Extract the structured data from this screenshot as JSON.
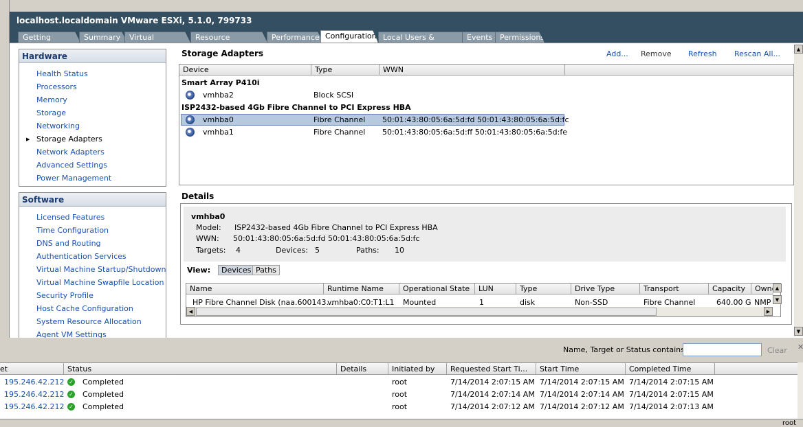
{
  "window_title": "localhost.localdomain VMware ESXi, 5.1.0, 799733",
  "tabs": [
    {
      "label": "Getting Started"
    },
    {
      "label": "Summary"
    },
    {
      "label": "Virtual Machines"
    },
    {
      "label": "Resource Allocation"
    },
    {
      "label": "Performance"
    },
    {
      "label": "Configuration"
    },
    {
      "label": "Local Users & Groups"
    },
    {
      "label": "Events"
    },
    {
      "label": "Permissions"
    }
  ],
  "active_tab": "Configuration",
  "hardware": {
    "title": "Hardware",
    "items": [
      "Health Status",
      "Processors",
      "Memory",
      "Storage",
      "Networking",
      "Storage Adapters",
      "Network Adapters",
      "Advanced Settings",
      "Power Management"
    ],
    "selected": "Storage Adapters"
  },
  "software": {
    "title": "Software",
    "items": [
      "Licensed Features",
      "Time Configuration",
      "DNS and Routing",
      "Authentication Services",
      "Virtual Machine Startup/Shutdown",
      "Virtual Machine Swapfile Location",
      "Security Profile",
      "Host Cache Configuration",
      "System Resource Allocation",
      "Agent VM Settings"
    ]
  },
  "storage_adapters": {
    "title": "Storage Adapters",
    "actions": {
      "add": "Add...",
      "remove": "Remove",
      "refresh": "Refresh",
      "rescan": "Rescan All..."
    },
    "columns": [
      "Device",
      "Type",
      "WWN"
    ],
    "groups": [
      {
        "name": "Smart Array P410i"
      },
      {
        "name": "ISP2432-based 4Gb Fibre Channel to PCI Express HBA"
      }
    ],
    "rows": [
      {
        "device": "vmhba2",
        "type": "Block SCSI",
        "wwn": ""
      },
      {
        "device": "vmhba0",
        "type": "Fibre Channel",
        "wwn": "50:01:43:80:05:6a:5d:fd 50:01:43:80:05:6a:5d:fc"
      },
      {
        "device": "vmhba1",
        "type": "Fibre Channel",
        "wwn": "50:01:43:80:05:6a:5d:ff 50:01:43:80:05:6a:5d:fe"
      }
    ]
  },
  "details": {
    "title": "Details",
    "adapter": "vmhba0",
    "model_label": "Model:",
    "model": "ISP2432-based 4Gb Fibre Channel to PCI Express HBA",
    "wwn_label": "WWN:",
    "wwn": "50:01:43:80:05:6a:5d:fd 50:01:43:80:05:6a:5d:fc",
    "targets_label": "Targets:",
    "targets": "4",
    "devices_label": "Devices:",
    "devices": "5",
    "paths_label": "Paths:",
    "paths": "10",
    "view_label": "View:",
    "view_devices": "Devices",
    "view_paths": "Paths",
    "columns": [
      "Name",
      "Runtime Name",
      "Operational State",
      "LUN",
      "Type",
      "Drive Type",
      "Transport",
      "Capacity",
      "Owne"
    ],
    "row": {
      "name": "HP Fibre Channel Disk (naa.600143...",
      "runtime": "vmhba0:C0:T1:L1",
      "state": "Mounted",
      "lun": "1",
      "type": "disk",
      "drive": "Non-SSD",
      "transport": "Fibre Channel",
      "capacity": "640.00 G",
      "owner": "NMP"
    }
  },
  "tasks": {
    "filter_label": "Name, Target or Status contains: ▾",
    "filter_value": "",
    "clear": "Clear",
    "columns": [
      "et",
      "Status",
      "Details",
      "Initiated by",
      "Requested Start Ti...",
      "Start Time",
      "Completed Time"
    ],
    "rows": [
      {
        "target": "195.246.42.212",
        "status": "Completed",
        "details": "",
        "initiated": "root",
        "requested": "7/14/2014 2:07:15 AM",
        "start": "7/14/2014 2:07:15 AM",
        "completed": "7/14/2014 2:07:15 AM"
      },
      {
        "target": "195.246.42.212",
        "status": "Completed",
        "details": "",
        "initiated": "root",
        "requested": "7/14/2014 2:07:14 AM",
        "start": "7/14/2014 2:07:14 AM",
        "completed": "7/14/2014 2:07:15 AM"
      },
      {
        "target": "195.246.42.212",
        "status": "Completed",
        "details": "",
        "initiated": "root",
        "requested": "7/14/2014 2:07:12 AM",
        "start": "7/14/2014 2:07:12 AM",
        "completed": "7/14/2014 2:07:13 AM"
      }
    ]
  },
  "status_user": "root"
}
